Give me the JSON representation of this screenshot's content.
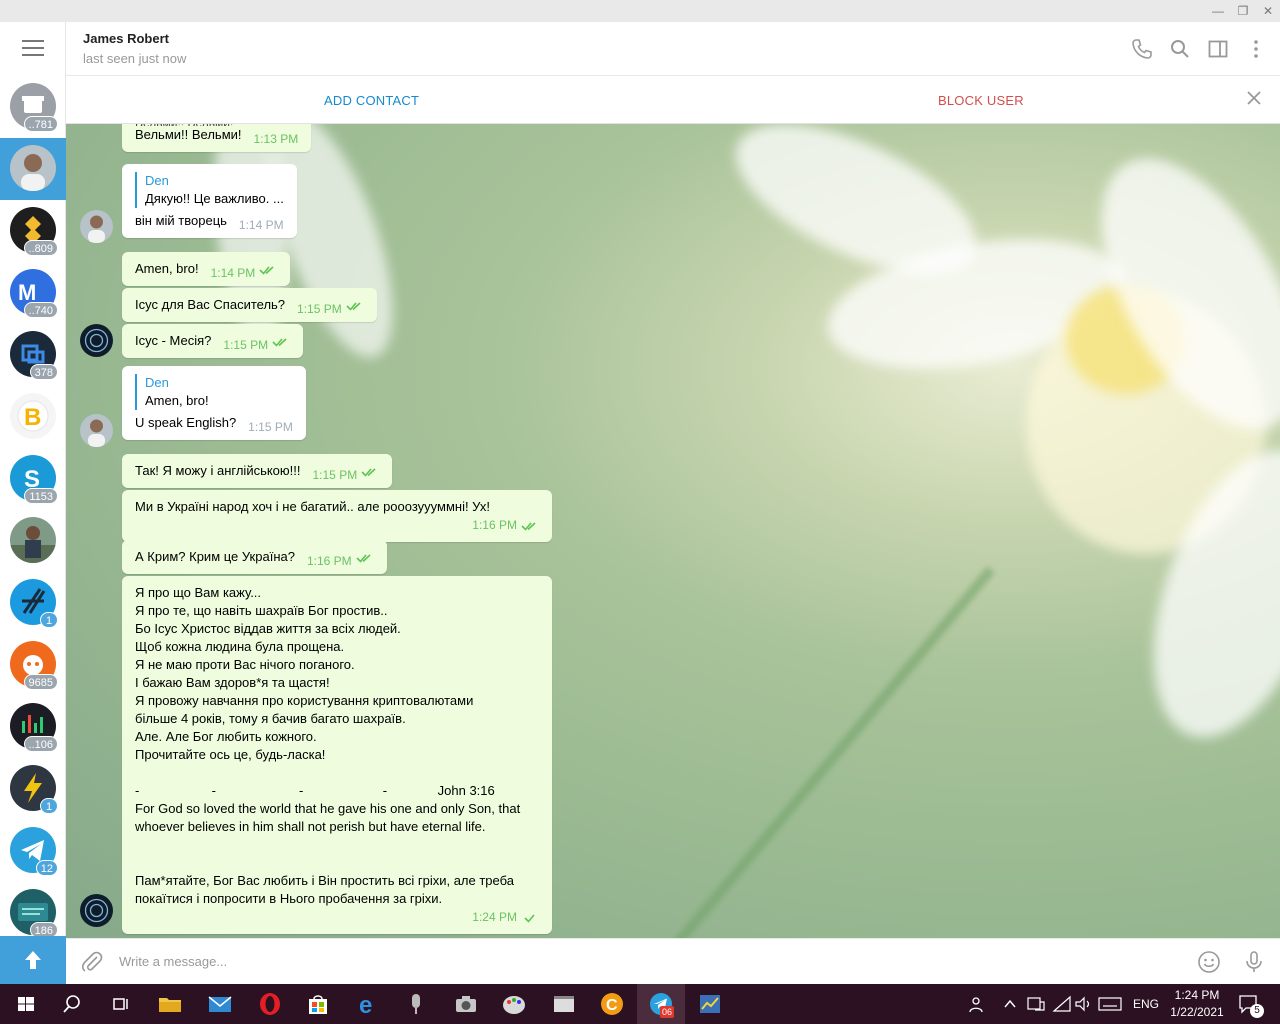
{
  "window": {
    "minimize": "—",
    "restore": "❐",
    "close": "✕"
  },
  "sidebar": {
    "items": [
      {
        "badge": "..781",
        "color": "#9aa0a6",
        "kind": "archive"
      },
      {
        "badge": "",
        "color": "#419fd9",
        "kind": "active"
      },
      {
        "badge": "..809",
        "color": "#1e1e1e",
        "kind": "binance"
      },
      {
        "badge": "..740",
        "color": "#2f6fe0",
        "kind": "coin"
      },
      {
        "badge": "378",
        "color": "#1b2a3a",
        "kind": "cube"
      },
      {
        "badge": "",
        "color": "#f3f3f3",
        "kind": "bitcoin"
      },
      {
        "badge": "1153",
        "color": "#1a9ad6",
        "kind": "s"
      },
      {
        "badge": "",
        "color": "#5a6e55",
        "kind": "photo"
      },
      {
        "badge": "1",
        "color": "#1c9ae0",
        "kind": "hash"
      },
      {
        "badge": "9685",
        "color": "#f06a1e",
        "kind": "bot"
      },
      {
        "badge": "..106",
        "color": "#1c1c24",
        "kind": "chart"
      },
      {
        "badge": "1",
        "color": "#2e3642",
        "kind": "lightning"
      },
      {
        "badge": "12",
        "color": "#2ba2de",
        "kind": "telegram"
      },
      {
        "badge": "186",
        "color": "#1f5f66",
        "kind": "problockchain"
      }
    ]
  },
  "header": {
    "name": "James Robert",
    "status": "last seen just now"
  },
  "actionbar": {
    "add_contact": "ADD CONTACT",
    "block_user": "BLOCK USER"
  },
  "messages": [
    {
      "type": "out",
      "text": "Вельми!! Вельми!",
      "time": "1:13 PM",
      "partial_quote": "Вельми!! Вельми!"
    },
    {
      "type": "in",
      "reply_name": "Den",
      "reply_text": "Дякую!! Це важливо. ...",
      "text": "він мій творець",
      "time": "1:14 PM"
    },
    {
      "type": "out",
      "text": "Amen, bro!",
      "time": "1:14 PM"
    },
    {
      "type": "out",
      "text": "Ісус для Вас Спаситель?",
      "time": "1:15 PM"
    },
    {
      "type": "out",
      "text": "Ісус - Месія?",
      "time": "1:15 PM"
    },
    {
      "type": "in",
      "reply_name": "Den",
      "reply_text": "Amen, bro!",
      "text": "U speak English?",
      "time": "1:15 PM"
    },
    {
      "type": "out",
      "text": "Так! Я можу і англійською!!!",
      "time": "1:15 PM"
    },
    {
      "type": "out",
      "text": "Ми в Україні народ хоч і не багатий.. але рооозуууммні! Ух!",
      "time": "1:16 PM"
    },
    {
      "type": "out",
      "text": "А Крим? Крим це Україна?",
      "time": "1:16 PM"
    },
    {
      "type": "out",
      "lines": [
        "Я про що Вам кажу...",
        "Я про те, що навіть шахраїв Бог простив..",
        "Бо Ісус Христос віддав життя за всіх людей.",
        "Щоб кожна людина була прощена.",
        "Я не маю проти Вас нічого поганого.",
        "І бажаю Вам здоров*я та щастя!",
        "Я провожу навчання про користування криптовалютами",
        "більше 4 років, тому я бачив багато шахраїв.",
        "Але. Але Бог любить кожного.",
        "Прочитайте ось це, будь-ласка!",
        "",
        "-                    -                       -                      -              John 3:16",
        "For God so loved the world that he gave his one and only Son, that",
        "whoever believes in him shall not perish but have eternal life.",
        "",
        "",
        "Пам*ятайте, Бог Вас любить і Він простить всі гріхи, але треба",
        "покаїтися і попросити в Нього пробачення за гріхи."
      ],
      "time": "1:24 PM"
    }
  ],
  "input": {
    "placeholder": "Write a message..."
  },
  "taskbar": {
    "lang": "ENG",
    "time": "1:24 PM",
    "date": "1/22/2021",
    "notif_count": "5",
    "telegram_badge": "06"
  }
}
